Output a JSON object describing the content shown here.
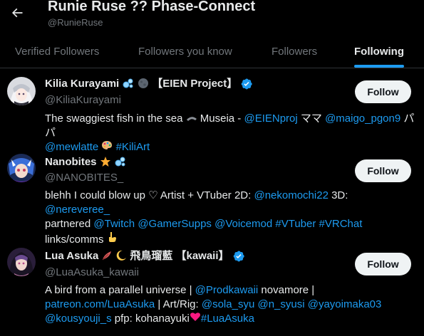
{
  "header": {
    "title": "Runie Ruse ?? Phase-Connect",
    "handle": "@RunieRuse"
  },
  "tabs": [
    {
      "label": "Verified Followers",
      "active": false
    },
    {
      "label": "Followers you know",
      "active": false
    },
    {
      "label": "Followers",
      "active": false
    },
    {
      "label": "Following",
      "active": true
    }
  ],
  "colors": {
    "accent": "#1d9bf0",
    "background": "#000000",
    "text": "#e7e9ea",
    "muted": "#71767b",
    "heart": "#f91880"
  },
  "users": [
    {
      "name": "Kilia Kurayami",
      "name_suffix": "【EIEN Project】",
      "handle": "@KiliaKurayami",
      "follow_label": "Follow",
      "bio": {
        "t1": "The swaggiest fish in the sea ",
        "t2": " Museia - ",
        "l1": "@EIENproj",
        "t3": " ママ ",
        "l2": "@maigo_pgon9",
        "t4": " パパ ",
        "l3": "@mewlatte",
        "t5": " ",
        "l4": "#KiliArt"
      }
    },
    {
      "name": "Nanobites",
      "handle": "@NANOBITES_",
      "follow_label": "Follow",
      "bio": {
        "t1": "blehh I could blow up ♡ Artist + VTuber 2D: ",
        "l1": "@nekomochi22",
        "t2": " 3D: ",
        "l2": "@nereveree_",
        "t3": "partnered ",
        "l3": "@Twitch",
        "t4": " ",
        "l4": "@GamerSupps",
        "t5": " ",
        "l5": "@Voicemod",
        "t6": " ",
        "l6": "#VTuber",
        "t7": " ",
        "l7": "#VRChat",
        "t8": "links/comms "
      }
    },
    {
      "name": "Lua Asuka",
      "name_suffix": "飛鳥瑠藍 【kawaii】",
      "handle": "@LuaAsuka_kawaii",
      "follow_label": "Follow",
      "bio": {
        "t1": "A bird from a parallel universe | ",
        "l1": "@Prodkawaii",
        "t2": " novamore |",
        "l2": "patreon.com/LuaAsuka",
        "t3": " | Art/Rig: ",
        "l3": "@sola_syu",
        "t4": " ",
        "l4": "@n_syusi",
        "t5": " ",
        "l5": "@yayoimaka03",
        "l6": "@kousyouji_s",
        "t6": " pfp: kohanayuki",
        "l7": "#LuaAsuka"
      }
    }
  ]
}
